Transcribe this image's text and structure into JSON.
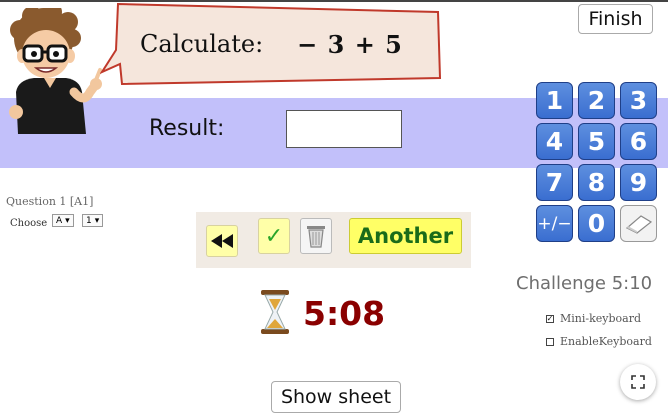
{
  "prompt": {
    "label": "Calculate:",
    "expression": "− 3 + 5"
  },
  "result": {
    "label": "Result:",
    "value": ""
  },
  "finish_label": "Finish",
  "keypad": {
    "keys": [
      "1",
      "2",
      "3",
      "4",
      "5",
      "6",
      "7",
      "8",
      "9",
      "+/−",
      "0"
    ],
    "erase_icon": "eraser-icon"
  },
  "question": {
    "title": "Question 1 [A1]",
    "choose_label": "Choose",
    "select_letter": "A",
    "select_number": "1"
  },
  "toolbar": {
    "rewind_icon": "rewind-icon",
    "check_symbol": "✓",
    "trash_icon": "trash-icon",
    "another_label": "Another"
  },
  "timer": {
    "icon": "hourglass-icon",
    "value": "5:08"
  },
  "challenge": {
    "text": "Challenge 5:10",
    "mini_keyboard_label": "Mini-keyboard",
    "mini_keyboard_checked": "☑",
    "enable_keyboard_label": "EnableKeyboard"
  },
  "show_sheet_label": "Show sheet",
  "colors": {
    "band": "#c2c0fa",
    "key_blue": "#3a6ed0",
    "timer": "#8a0000",
    "another_bg": "#ffff66",
    "another_text": "#1a6b1a"
  }
}
